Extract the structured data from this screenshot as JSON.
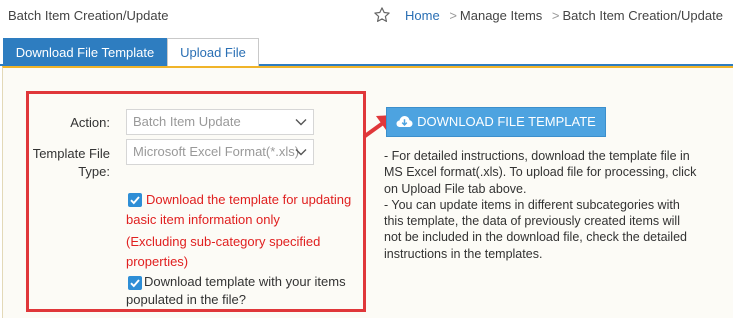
{
  "header": {
    "title": "Batch Item Creation/Update",
    "breadcrumb": {
      "home": "Home",
      "sep": ">",
      "items": [
        "Manage Items",
        "Batch Item Creation/Update"
      ]
    }
  },
  "tabs": [
    {
      "label": "Download File Template",
      "active": true
    },
    {
      "label": "Upload File",
      "active": false
    }
  ],
  "form": {
    "action_label": "Action:",
    "action_value": "Batch Item Update",
    "template_type_label_line1": "Template File",
    "template_type_label_line2": "Type:",
    "template_type_value": "Microsoft Excel Format(*.xls)",
    "checkbox1": {
      "checked": true,
      "lines": [
        "Download the template for updating",
        "basic item information only",
        "(Excluding sub-category specified",
        "properties)"
      ]
    },
    "checkbox2": {
      "checked": true,
      "lines": [
        "Download template with your items",
        "populated in the file?"
      ]
    }
  },
  "download_button": {
    "label": "DOWNLOAD FILE TEMPLATE",
    "icon": "cloud-download-icon"
  },
  "instructions": {
    "para1": [
      "- For detailed instructions, download the template file in",
      "MS Excel format(.xls). To upload file for processing, click",
      "on Upload File tab above."
    ],
    "para2": [
      "- You can update items in different subcategories with",
      "this template, the data of previously created items will",
      "not be included in the download file, check the detailed",
      "instructions in the templates."
    ]
  },
  "colors": {
    "primary": "#2e7dc0",
    "button": "#4da3e0",
    "highlight_box": "#e0373a",
    "warning_text": "#e02020",
    "panel_border": "#f0b429"
  }
}
